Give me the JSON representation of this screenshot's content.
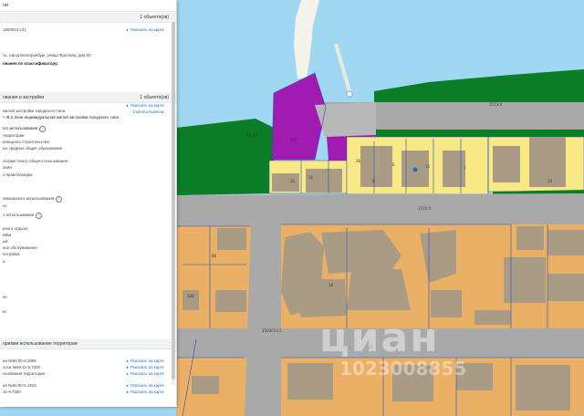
{
  "panel": {
    "title": "ни",
    "section1": {
      "count": "1 объекта(ов)",
      "cadastral": "1503013:141",
      "show_on_map": "Показать на карте",
      "address": "ть, город Екатеринбург, улица Фролова, дом 50",
      "classifier": "ования по классификатору:"
    },
    "section2": {
      "title": "ования и застройки",
      "count": "1 объекта(ов)",
      "zone_label": "жилой застройки городского типа",
      "zone_value": "т Ж-2 Зона индивидуальной жилой застройки городского типа",
      "show_on_map": "Показать на карте",
      "download": "Скачать выписку",
      "main_use_head": "ого использования",
      "main_use_items": [
        "территории",
        "илищного строительства",
        "ых средних общее образование",
        "",
        "ого(местного) общего пользования",
        "ания",
        "о правопорядка"
      ],
      "conditional_head": "овешенного использования",
      "conditional_items": [
        "ос"
      ],
      "aux_head": "о использования",
      "aux_items": [
        "рного отдыха",
        "ийка",
        "ый",
        "ное обслуживание",
        "острайка",
        "а"
      ],
      "tail_items": [
        "не",
        "нс"
      ]
    },
    "section3": {
      "title": "ориями использования территории",
      "rows": [
        {
          "text": "ия №66:00-6.1908",
          "link": "Показать на карте"
        },
        {
          "text": "хоса №66:41-6.7250",
          "link": "Показать на карте"
        },
        {
          "text": "льзования территории",
          "link": "Показать на карте"
        },
        {
          "text": "ия №66:00-6.1915",
          "link": "Показать на карте"
        },
        {
          "text": "41-6.7250",
          "link": "Показать на карте"
        }
      ]
    }
  },
  "map": {
    "labels": [
      "1513:4",
      "157",
      "15",
      "2Б",
      "26",
      "15",
      "6",
      "7",
      "9",
      "10",
      "80",
      "18",
      "106",
      "21",
      "1515:4",
      "66:41:",
      "1503013:5"
    ],
    "watermark": "циан",
    "watermark_sub": "1023008855"
  }
}
